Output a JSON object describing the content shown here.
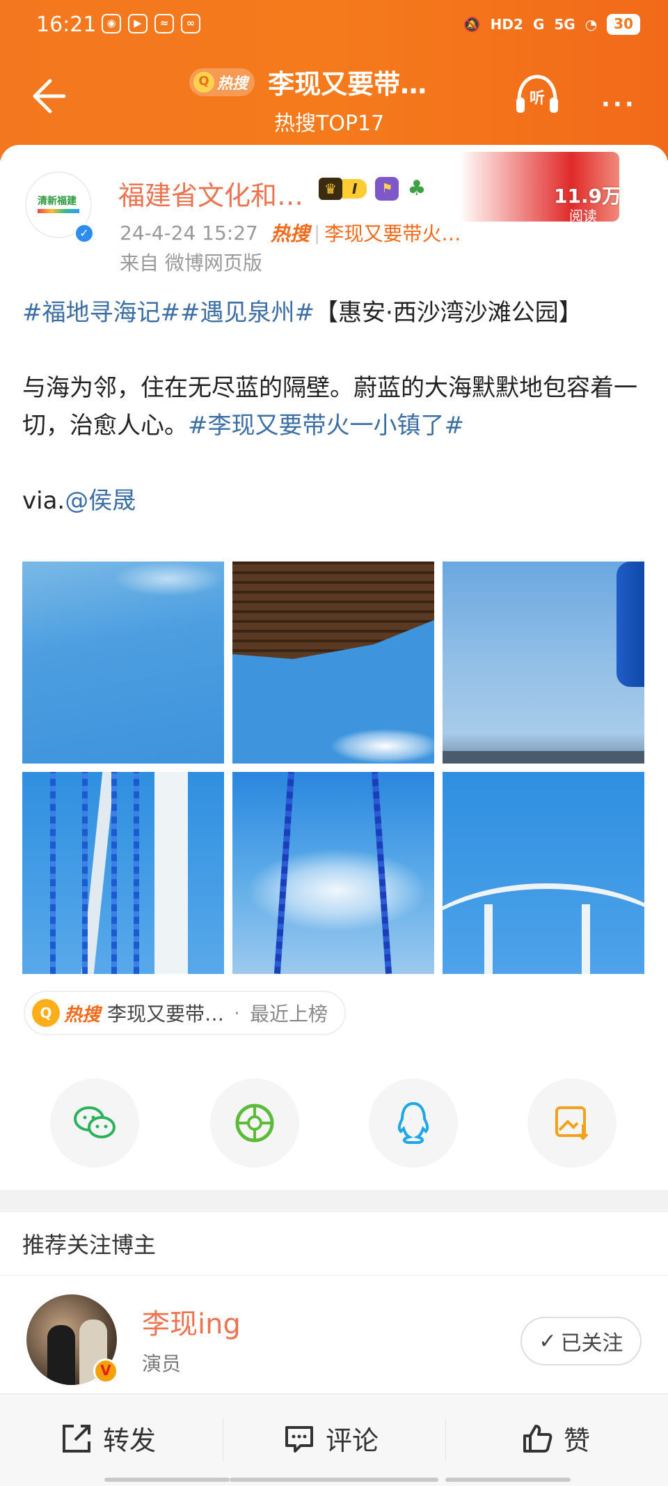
{
  "status_bar": {
    "time": "16:21",
    "app_icons": [
      "weibo-icon",
      "play-icon",
      "audio-icon",
      "link-icon"
    ],
    "network": "HD2",
    "signal1": "G",
    "signal2": "5G",
    "battery": "30"
  },
  "nav": {
    "hot_label": "热搜",
    "title": "李现又要带…",
    "subtitle": "热搜TOP17",
    "listen_label": "听",
    "more_label": "···"
  },
  "post": {
    "author": "福建省文化和…",
    "level_badge": "I",
    "read_count": "11.9万",
    "read_label": "阅读",
    "date": "24-4-24 15:27",
    "hot_word": "热搜",
    "hot_topic": "李现又要带火…",
    "source": "来自 微博网页版",
    "line1_tag1": "#福地寻海记#",
    "line1_tag2": "#遇见泉州#",
    "line1_text": "【惠安·西沙湾沙滩公园】",
    "line2_text": "与海为邻，住在无尽蓝的隔壁。蔚蓝的大海默默地包容着一切，治愈人心。",
    "line2_tag": "#李现又要带火一小镇了#",
    "via_prefix": "via.",
    "via_mention": "@侯晟",
    "photos": [
      "sky-photo",
      "roof-sky-photo",
      "flag-sea-photo",
      "rope-posts-photo",
      "swing-photo",
      "arc-structure-photo"
    ]
  },
  "hot_chip": {
    "hot_word": "热搜",
    "topic": "李现又要带…",
    "dot": "·",
    "status": "最近上榜"
  },
  "share": {
    "items": [
      "wechat-icon",
      "moments-icon",
      "qq-icon",
      "save-image-icon"
    ],
    "colors": {
      "wechat": "#2bb35b",
      "moments": "#5dbb3a",
      "qq": "#1da7e8",
      "save": "#f2a21a"
    }
  },
  "recommend": {
    "title": "推荐关注博主",
    "name": "李现ing",
    "description": "演员",
    "follow_label": "已关注"
  },
  "bottom_bar": {
    "repost": "转发",
    "comment": "评论",
    "like": "赞"
  },
  "colors": {
    "brand_orange": "#f3771e",
    "link_blue": "#3b6ea5",
    "author_orange": "#eb7350"
  }
}
